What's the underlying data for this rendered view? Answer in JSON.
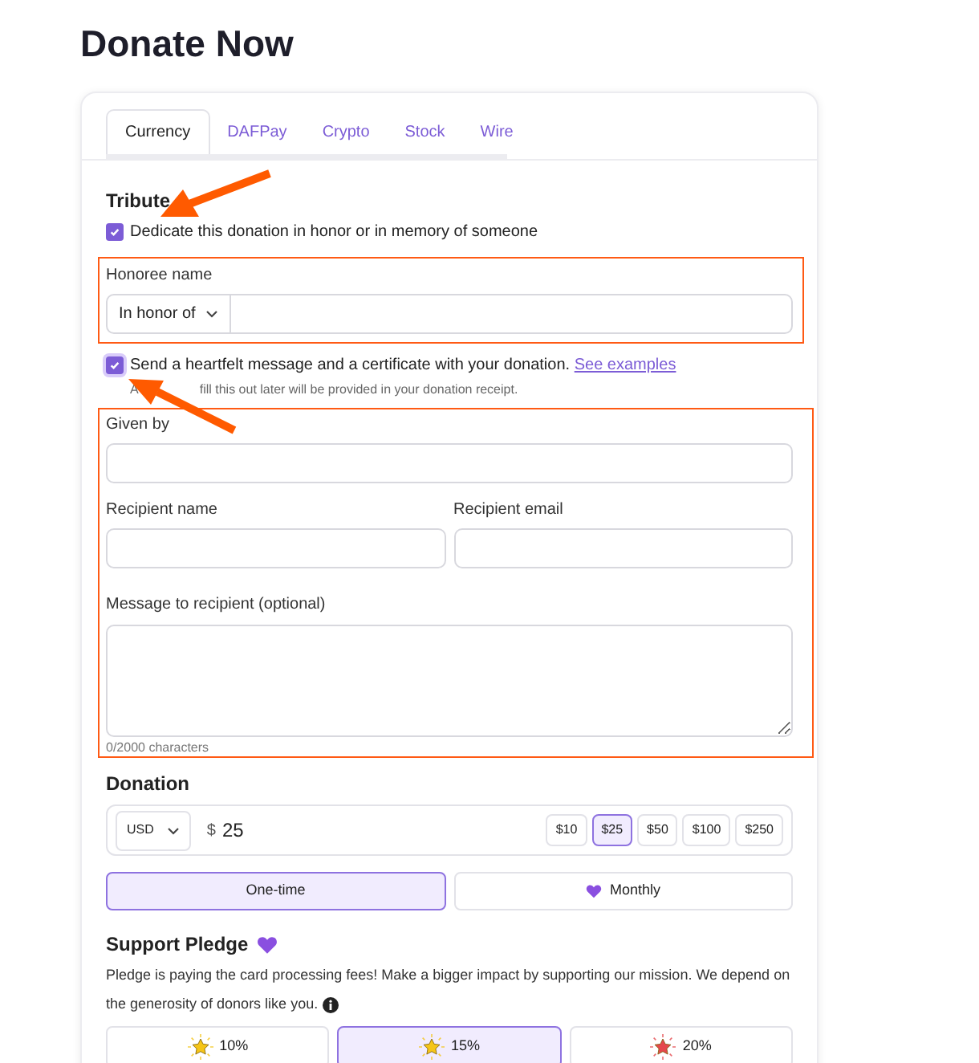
{
  "page": {
    "title": "Donate Now"
  },
  "tabs": [
    {
      "label": "Currency",
      "selected": true
    },
    {
      "label": "DAFPay",
      "selected": false
    },
    {
      "label": "Crypto",
      "selected": false
    },
    {
      "label": "Stock",
      "selected": false
    },
    {
      "label": "Wire",
      "selected": false
    }
  ],
  "tribute": {
    "heading": "Tribute",
    "dedicate": {
      "label": "Dedicate this donation in honor or in memory of someone",
      "checked": true
    },
    "honoree": {
      "label": "Honoree name",
      "select": "In honor of"
    },
    "message": {
      "label": "Send a heartfelt message and a certificate with your donation.",
      "link": "See examples",
      "checked": true
    },
    "note_start": "A",
    "note_end": "fill this out later will be provided in your donation receipt.",
    "given_by": "Given by",
    "recipient_name": "Recipient name",
    "recipient_email": "Recipient email",
    "message_label": "Message to recipient (optional)",
    "counter": "0/2000 characters"
  },
  "donation": {
    "heading": "Donation",
    "currency": "USD",
    "symbol": "$",
    "amount": "25",
    "presets": [
      {
        "label": "$10",
        "selected": false
      },
      {
        "label": "$25",
        "selected": true
      },
      {
        "label": "$50",
        "selected": false
      },
      {
        "label": "$100",
        "selected": false
      },
      {
        "label": "$250",
        "selected": false
      }
    ],
    "frequency": [
      {
        "label": "One-time",
        "selected": true,
        "heart": false
      },
      {
        "label": "Monthly",
        "selected": false,
        "heart": true
      }
    ]
  },
  "pledge": {
    "heading": "Support Pledge",
    "text": "Pledge is paying the card processing fees! Make a bigger impact by supporting our mission. We depend on the generosity of donors like you.",
    "options": [
      {
        "label": "10%",
        "selected": false,
        "color": "#f5c518"
      },
      {
        "label": "15%",
        "selected": true,
        "color": "#f5c518"
      },
      {
        "label": "20%",
        "selected": false,
        "color": "#e5484d"
      }
    ]
  }
}
